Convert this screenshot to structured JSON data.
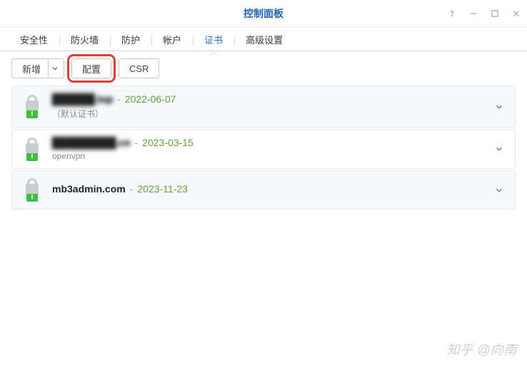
{
  "window": {
    "title": "控制面板"
  },
  "tabs": [
    {
      "label": "安全性",
      "active": false
    },
    {
      "label": "防火墙",
      "active": false
    },
    {
      "label": "防护",
      "active": false
    },
    {
      "label": "帐户",
      "active": false
    },
    {
      "label": "证书",
      "active": true
    },
    {
      "label": "高级设置",
      "active": false
    }
  ],
  "toolbar": {
    "add_label": "新增",
    "config_label": "配置",
    "csr_label": "CSR"
  },
  "certs": [
    {
      "domain_display": "██████.top",
      "blurred": true,
      "date": "2022-06-07",
      "subtitle": "（默认证书）"
    },
    {
      "domain_display": "█████████.cn",
      "blurred": true,
      "date": "2023-03-15",
      "subtitle": "openvpn"
    },
    {
      "domain_display": "mb3admin.com",
      "blurred": false,
      "date": "2023-11-23",
      "subtitle": ""
    }
  ],
  "watermark": "知乎 @向南"
}
